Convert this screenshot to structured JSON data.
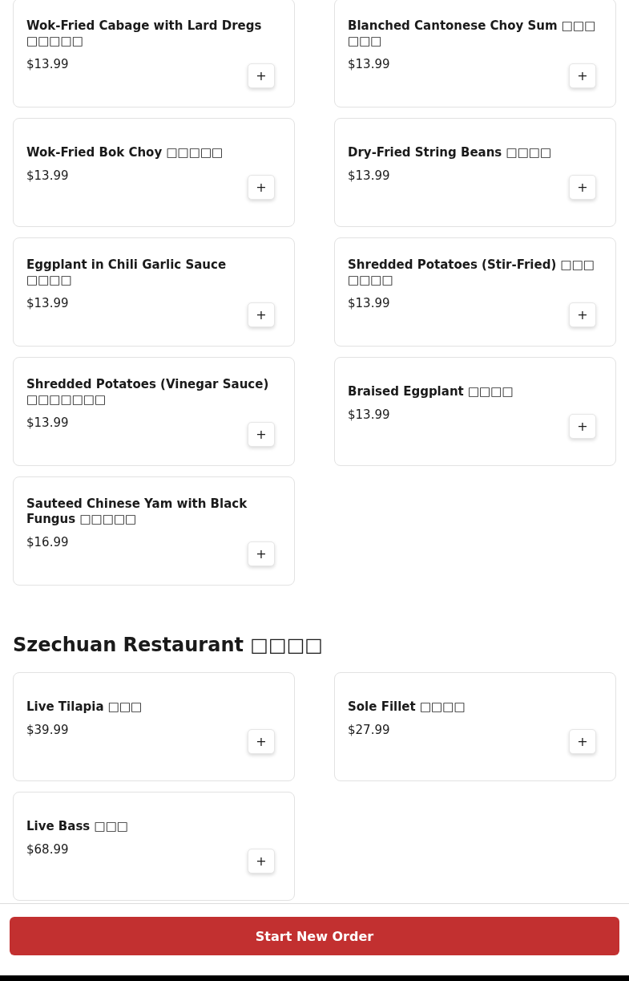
{
  "sections": [
    {
      "items": [
        {
          "name": "Wok-Fried Cabage with Lard Dregs □□□□□",
          "price": "$13.99"
        },
        {
          "name": "Blanched Cantonese Choy Sum □□□ □□□",
          "price": "$13.99"
        },
        {
          "name": "Wok-Fried Bok Choy □□□□□",
          "price": "$13.99"
        },
        {
          "name": "Dry-Fried String Beans □□□□",
          "price": "$13.99"
        },
        {
          "name": "Eggplant in Chili Garlic Sauce □□□□",
          "price": "$13.99"
        },
        {
          "name": "Shredded Potatoes (Stir-Fried) □□□ □□□□",
          "price": "$13.99"
        },
        {
          "name": "Shredded Potatoes (Vinegar Sauce) □□□□□□□",
          "price": "$13.99"
        },
        {
          "name": "Braised Eggplant □□□□",
          "price": "$13.99"
        },
        {
          "name": "Sauteed Chinese Yam with Black Fungus □□□□□",
          "price": "$16.99"
        }
      ]
    },
    {
      "title": "Szechuan Restaurant □□□□",
      "items": [
        {
          "name": "Live Tilapia □□□",
          "price": "$39.99"
        },
        {
          "name": "Sole Fillet □□□□",
          "price": "$27.99"
        },
        {
          "name": "Live Bass □□□",
          "price": "$68.99"
        }
      ]
    }
  ],
  "add_button": "+",
  "footer": {
    "button": "Start New Order"
  }
}
